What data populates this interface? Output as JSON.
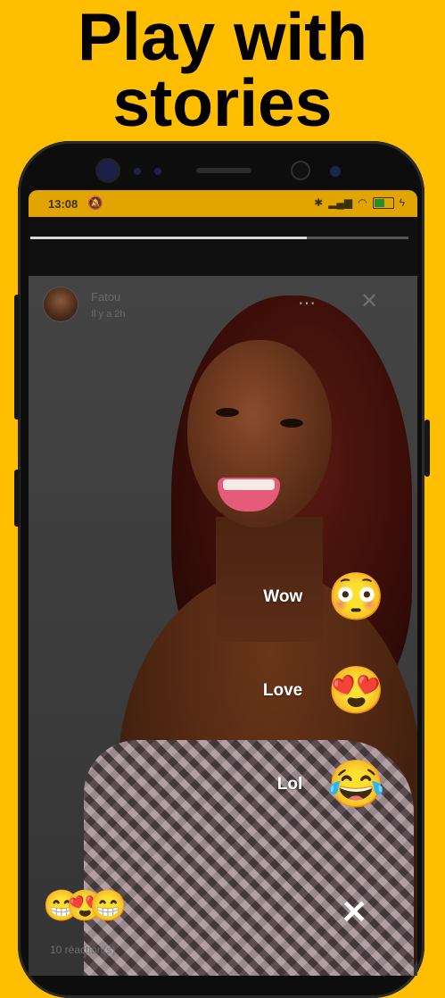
{
  "promo": {
    "headline_line1": "Play with",
    "headline_line2": "stories"
  },
  "status_bar": {
    "time": "13:08"
  },
  "story": {
    "progress": 0.73,
    "author_name": "Fatou",
    "posted_ago": "Il y a 2h",
    "more_icon": "⋯",
    "close_icon": "✕"
  },
  "reactions": [
    {
      "label": "Wow",
      "emoji": "😳"
    },
    {
      "label": "Love",
      "emoji": "😍"
    },
    {
      "label": "Lol",
      "emoji": "😂"
    }
  ],
  "reaction_summary": {
    "emojis": [
      "😁",
      "😍",
      "😁"
    ],
    "count_text": "10 réaction(s)",
    "close_icon": "✕"
  },
  "colors": {
    "background": "#FFBE00",
    "status_bar": "#E2A400"
  }
}
